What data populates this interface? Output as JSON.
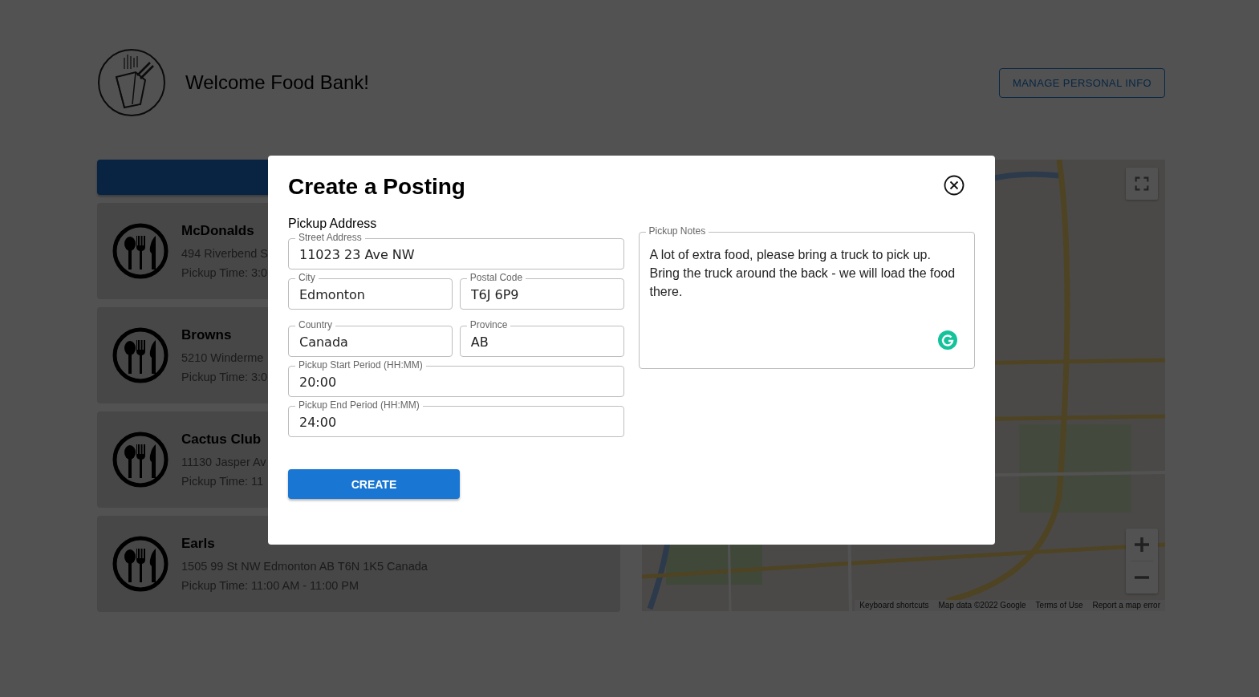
{
  "header": {
    "welcome": "Welcome Food Bank!",
    "manage_button": "MANAGE PERSONAL INFO"
  },
  "restaurants": [
    {
      "name": "McDonalds",
      "address": "494 Riverbend S",
      "pickup_time": "Pickup Time: 3:0"
    },
    {
      "name": "Browns",
      "address": "5210 Winderme",
      "pickup_time": "Pickup Time: 3:0"
    },
    {
      "name": "Cactus Club",
      "address": "11130 Jasper Av",
      "pickup_time": "Pickup Time: 11"
    },
    {
      "name": "Earls",
      "address": "1505 99 St NW Edmonton AB T6N 1K5 Canada",
      "pickup_time": "Pickup Time: 11:00 AM - 11:00 PM"
    }
  ],
  "map": {
    "kind": "picture",
    "attribution": [
      "Keyboard shortcuts",
      "Map data ©2022 Google",
      "Terms of Use",
      "Report a map error"
    ]
  },
  "modal": {
    "title": "Create a Posting",
    "section_label": "Pickup Address",
    "field_rows": [
      [
        {
          "label": "Street Address",
          "value": "11023 23 Ave NW"
        }
      ],
      [
        {
          "label": "City",
          "value": "Edmonton"
        },
        {
          "label": "Postal Code",
          "value": "T6J 6P9"
        }
      ],
      [
        {
          "label": "Country",
          "value": "Canada"
        },
        {
          "label": "Province",
          "value": "AB"
        }
      ],
      [
        {
          "label": "Pickup Start Period (HH:MM)",
          "value": "20:00"
        }
      ],
      [
        {
          "label": "Pickup End Period (HH:MM)",
          "value": "24:00"
        }
      ]
    ],
    "notes": {
      "label": "Pickup Notes",
      "value": "A lot of extra food, please bring a truck to pick up. Bring the truck around the back - we will load the food there."
    },
    "create_button": "CREATE"
  }
}
